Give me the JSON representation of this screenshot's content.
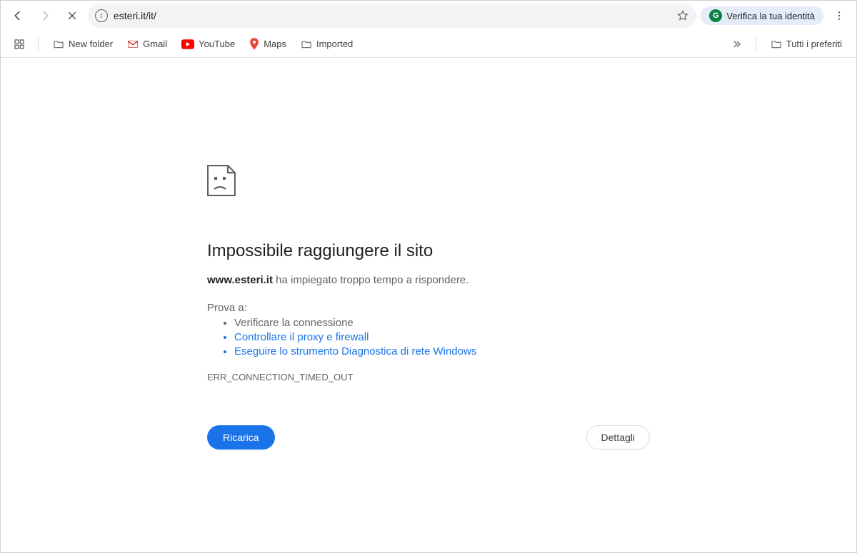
{
  "toolbar": {
    "url": "esteri.it/it/",
    "identity_label": "Verifica la tua identità"
  },
  "bookmarks": {
    "items": [
      {
        "label": "New folder",
        "icon": "folder"
      },
      {
        "label": "Gmail",
        "icon": "gmail"
      },
      {
        "label": "YouTube",
        "icon": "youtube"
      },
      {
        "label": "Maps",
        "icon": "maps"
      },
      {
        "label": "Imported",
        "icon": "folder"
      }
    ],
    "all_bookmarks_label": "Tutti i preferiti"
  },
  "error": {
    "title": "Impossibile raggiungere il sito",
    "host": "www.esteri.it",
    "message_suffix": " ha impiegato troppo tempo a rispondere.",
    "try_label": "Prova a:",
    "suggestions": [
      {
        "text": "Verificare la connessione",
        "link": false
      },
      {
        "text": "Controllare il proxy e firewall",
        "link": true
      },
      {
        "text": "Eseguire lo strumento Diagnostica di rete Windows",
        "link": true
      }
    ],
    "code": "ERR_CONNECTION_TIMED_OUT",
    "reload_label": "Ricarica",
    "details_label": "Dettagli"
  }
}
